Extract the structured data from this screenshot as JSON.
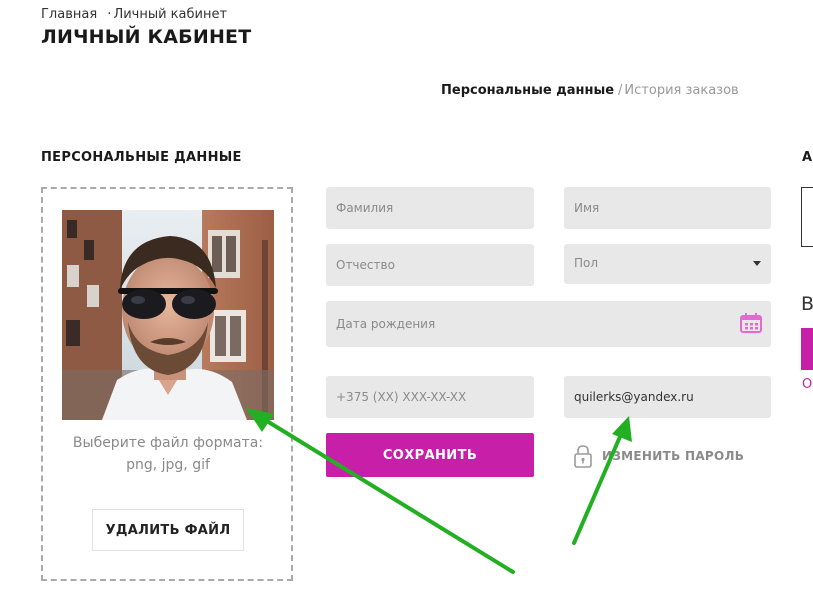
{
  "breadcrumb": {
    "home": "Главная",
    "separator": "·",
    "current": "Личный кабинет"
  },
  "page_title": "ЛИЧНЫЙ КАБИНЕТ",
  "tabs": {
    "personal": "Персональные данные",
    "separator": "/",
    "orders": "История заказов"
  },
  "personal": {
    "heading": "ПЕРСОНАЛЬНЫЕ ДАННЫЕ",
    "upload_hint_line1": "Выберите файл формата:",
    "upload_hint_line2": "png, jpg, gif",
    "delete_button": "УДАЛИТЬ ФАЙЛ"
  },
  "form": {
    "last_name_placeholder": "Фамилия",
    "first_name_placeholder": "Имя",
    "middle_name_placeholder": "Отчество",
    "gender_selected": "Пол",
    "birth_date_placeholder": "Дата рождения",
    "phone_placeholder": "+375 (XX) XXX-XX-XX",
    "email_value": "quilerks@yandex.ru",
    "save_button": "СОХРАНИТЬ",
    "change_password": "ИЗМЕНИТЬ ПАРОЛЬ"
  },
  "right_partial": {
    "heading_letter": "А",
    "letter2": "В",
    "link_letter": "О"
  },
  "icons": {
    "calendar": "calendar-icon",
    "lock": "lock-icon",
    "caret": "chevron-down-icon"
  },
  "colors": {
    "accent": "#c81fa8",
    "field_bg": "#e8e8e8",
    "arrow": "#22b022"
  }
}
